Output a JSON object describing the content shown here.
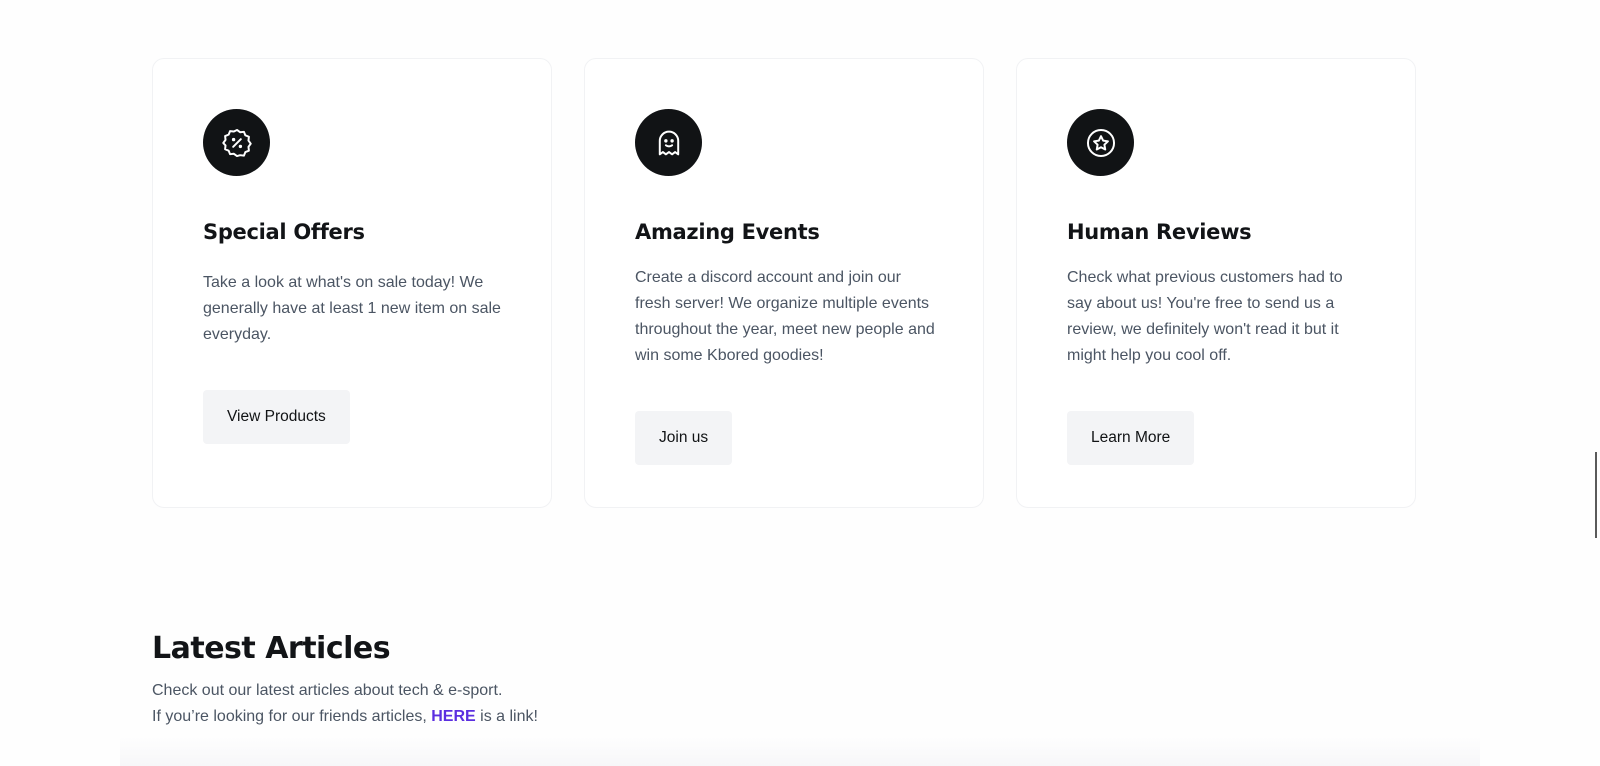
{
  "cards": [
    {
      "icon": "discount-badge-icon",
      "title": "Special Offers",
      "text": "Take a look at what's on sale today! We generally have at least 1 new item on sale everyday.",
      "button": "View Products"
    },
    {
      "icon": "ghost-icon",
      "title": "Amazing Events",
      "text": "Create a discord account and join our fresh server! We organize multiple events throughout the year, meet new people and win some Kbored goodies!",
      "button": "Join us"
    },
    {
      "icon": "star-circle-icon",
      "title": "Human Reviews",
      "text": "Check what previous customers had to say about us! You're free to send us a review, we definitely won't read it but it might help you cool off.",
      "button": "Learn More"
    }
  ],
  "articles": {
    "title": "Latest Articles",
    "line1": "Check out our latest articles about tech & e-sport.",
    "line2_prefix": "If you’re looking for our friends articles, ",
    "link_text": "HERE",
    "line2_suffix": " is a link!"
  },
  "colors": {
    "icon_bg": "#111315",
    "button_bg": "#f3f4f6",
    "link": "#5b2ee0",
    "body_text": "#4b5563",
    "heading": "#121417"
  }
}
